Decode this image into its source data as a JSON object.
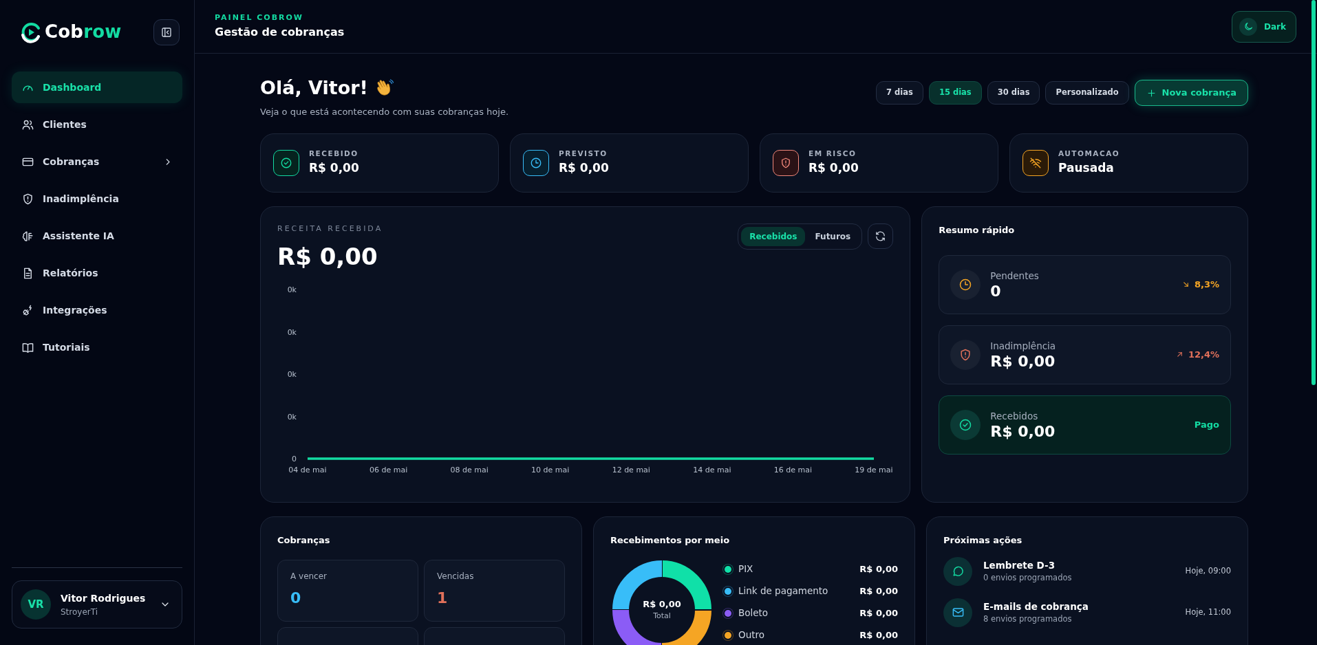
{
  "sidebar": {
    "brand": {
      "lead": "Cob",
      "accent": "row"
    },
    "items": [
      {
        "label": "Dashboard",
        "kind": "dashboard",
        "selected": true,
        "submenu": false
      },
      {
        "label": "Clientes",
        "kind": "clients",
        "selected": false,
        "submenu": false
      },
      {
        "label": "Cobranças",
        "kind": "charges",
        "selected": false,
        "submenu": true
      },
      {
        "label": "Inadimplência",
        "kind": "defaults",
        "selected": false,
        "submenu": false
      },
      {
        "label": "Assistente IA",
        "kind": "assistant",
        "selected": false,
        "submenu": false
      },
      {
        "label": "Relatórios",
        "kind": "reports",
        "selected": false,
        "submenu": false
      },
      {
        "label": "Integrações",
        "kind": "integrations",
        "selected": false,
        "submenu": false
      },
      {
        "label": "Tutoriais",
        "kind": "tutorials",
        "selected": false,
        "submenu": false
      }
    ],
    "user": {
      "initials": "VR",
      "name": "Vitor Rodrigues",
      "org": "StroyerTi"
    }
  },
  "header": {
    "eyebrow": "PAINEL COBROW",
    "title": "Gestão de cobranças",
    "theme_toggle": "Dark"
  },
  "greeting": {
    "title": "Olá, Vitor!",
    "subtitle": "Veja o que está acontecendo com suas cobranças hoje."
  },
  "periods": [
    {
      "label": "7 dias",
      "selected": false
    },
    {
      "label": "15 dias",
      "selected": true
    },
    {
      "label": "30 dias",
      "selected": false
    },
    {
      "label": "Personalizado",
      "selected": false
    }
  ],
  "new_button": "Nova cobrança",
  "stats": [
    {
      "kind": "received",
      "label": "RECEBIDO",
      "value": "R$ 0,00"
    },
    {
      "kind": "forecast",
      "label": "PREVISTO",
      "value": "R$ 0,00"
    },
    {
      "kind": "risk",
      "label": "EM RISCO",
      "value": "R$ 0,00"
    },
    {
      "kind": "automation",
      "label": "AUTOMACAO",
      "value": "Pausada"
    }
  ],
  "revenue": {
    "eyebrow": "RECEITA RECEBIDA",
    "amount": "R$ 0,00",
    "toggle": [
      {
        "label": "Recebidos",
        "selected": true
      },
      {
        "label": "Futuros",
        "selected": false
      }
    ],
    "chart_data": {
      "type": "line",
      "categories": [
        "04 de mai",
        "06 de mai",
        "08 de mai",
        "10 de mai",
        "12 de mai",
        "14 de mai",
        "16 de mai",
        "19 de mai"
      ],
      "series": [
        {
          "color": "#13dba2",
          "values": [
            0,
            0,
            0,
            0,
            0,
            0,
            0,
            0
          ]
        }
      ],
      "ylim": [
        0,
        1
      ],
      "yticks": [
        {
          "value": 0,
          "label": "0"
        },
        {
          "value": 0.25,
          "label": "0k"
        },
        {
          "value": 0.5,
          "label": "0k"
        },
        {
          "value": 0.75,
          "label": "0k"
        },
        {
          "value": 1,
          "label": "0k"
        }
      ]
    }
  },
  "summary": {
    "title": "Resumo rápido",
    "items": [
      {
        "kind": "pending",
        "label": "Pendentes",
        "value": "0",
        "trend": "8,3%",
        "highlighted": false
      },
      {
        "kind": "overdue",
        "label": "Inadimplência",
        "value": "R$ 0,00",
        "trend": "12,4%",
        "highlighted": false
      },
      {
        "kind": "received",
        "label": "Recebidos",
        "value": "R$ 0,00",
        "trend": "Pago",
        "highlighted": true
      }
    ]
  },
  "charges": {
    "title": "Cobranças",
    "tiles": [
      {
        "kind": "upcoming",
        "label": "A vencer",
        "value": "0"
      },
      {
        "kind": "overdue",
        "label": "Vencidas",
        "value": "1"
      }
    ]
  },
  "methods": {
    "title": "Recebimentos por meio",
    "total": "R$ 0,00",
    "total_label": "Total",
    "items": [
      {
        "label": "PIX",
        "value": "R$ 0,00",
        "color": "#10e0a8"
      },
      {
        "label": "Link de pagamento",
        "value": "R$ 0,00",
        "color": "#38bdf8"
      },
      {
        "label": "Boleto",
        "value": "R$ 0,00",
        "color": "#8b5cf6"
      },
      {
        "label": "Outro",
        "value": "R$ 0,00",
        "color": "#f5a524"
      }
    ]
  },
  "actions": {
    "title": "Próximas ações",
    "items": [
      {
        "kind": "chat",
        "title": "Lembrete D-3",
        "subtitle": "0 envios programados",
        "time": "Hoje, 09:00"
      },
      {
        "kind": "mail",
        "title": "E-mails de cobrança",
        "subtitle": "8 envios programados",
        "time": "Hoje, 11:00"
      }
    ]
  }
}
